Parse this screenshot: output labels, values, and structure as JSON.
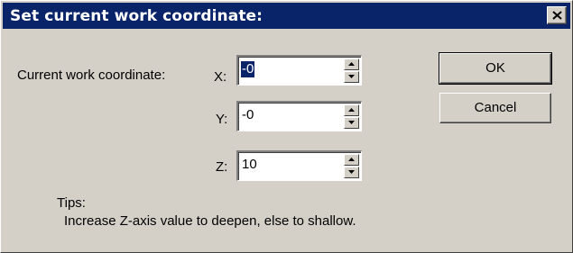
{
  "dialog": {
    "title": "Set current work coordinate:",
    "close_glyph": "×"
  },
  "form": {
    "group_label": "Current work coordinate:",
    "x": {
      "label": "X:",
      "value": "-0"
    },
    "y": {
      "label": "Y:",
      "value": "-0"
    },
    "z": {
      "label": "Z:",
      "value": "10"
    }
  },
  "buttons": {
    "ok": "OK",
    "cancel": "Cancel"
  },
  "tips": {
    "heading": "Tips:",
    "text": "Increase Z-axis value to deepen, else to shallow."
  },
  "colors": {
    "titlebar": "#0a246a",
    "face": "#d4d0c8",
    "selection": "#0a246a"
  },
  "icons": [
    "close-icon",
    "spin-up-icon",
    "spin-down-icon"
  ]
}
